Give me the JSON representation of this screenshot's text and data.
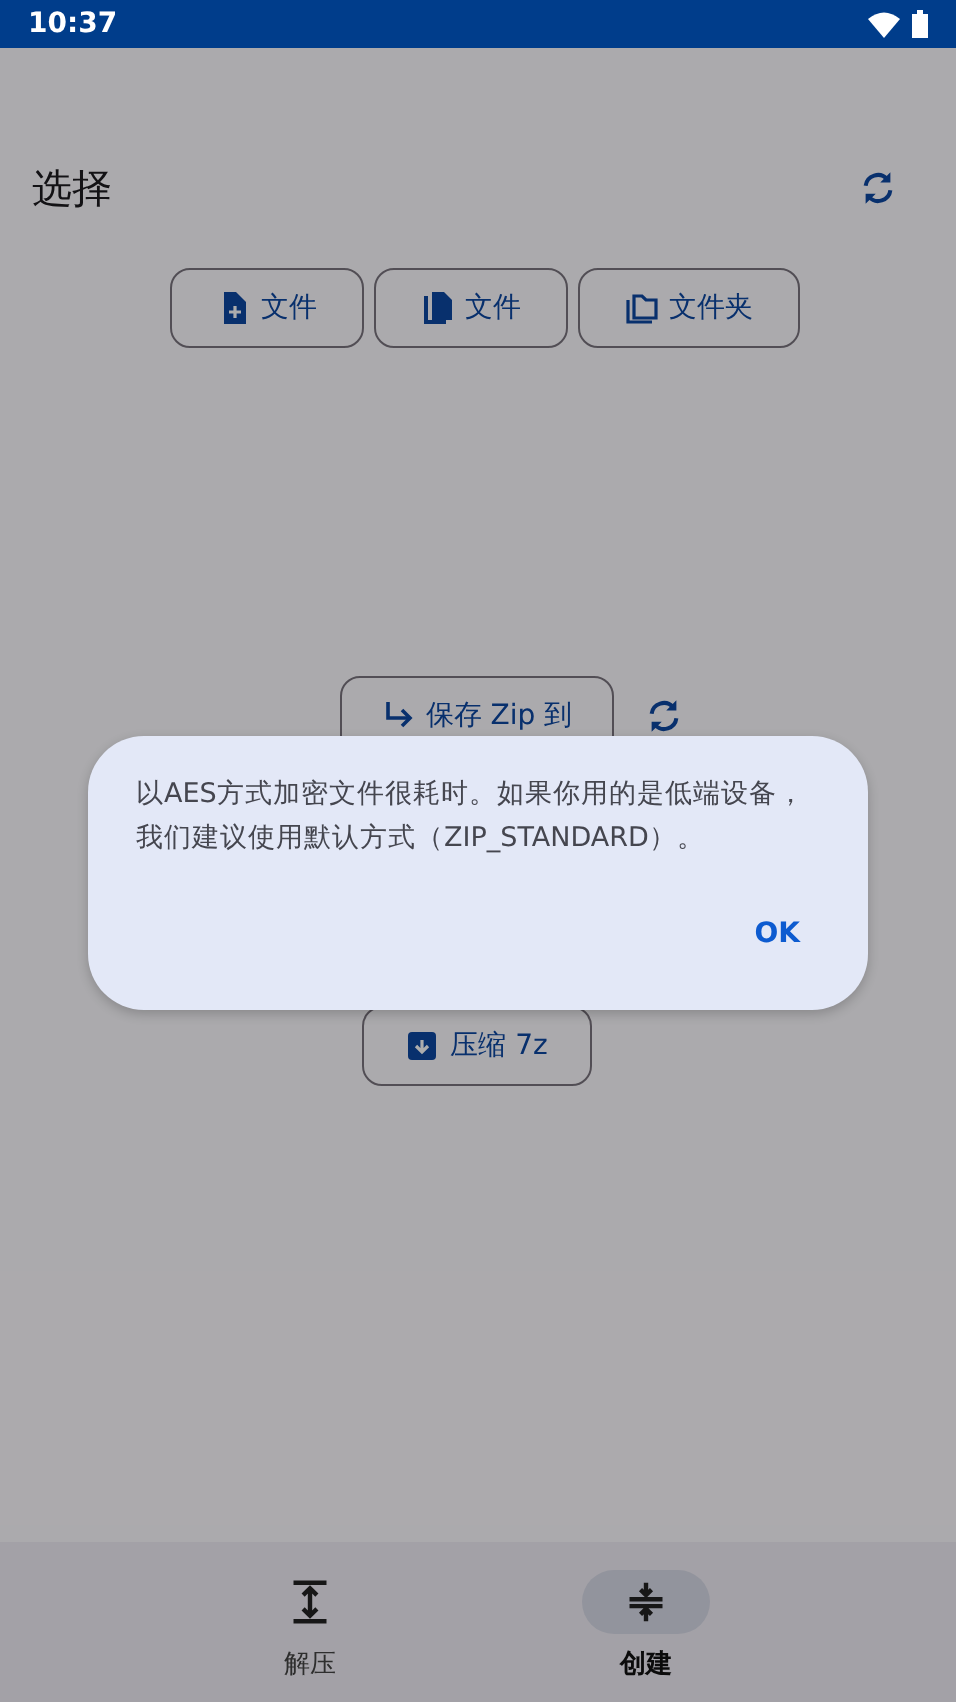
{
  "status_bar": {
    "time": "10:37"
  },
  "title": "选择",
  "source_buttons": [
    {
      "kind": "file-add",
      "label": "文件"
    },
    {
      "kind": "files",
      "label": "文件"
    },
    {
      "kind": "folder",
      "label": "文件夹"
    }
  ],
  "save_button": {
    "label": "保存 Zip 到"
  },
  "compress_button": {
    "label": "压缩 7z"
  },
  "dialog": {
    "message": "以AES方式加密文件很耗时。如果你用的是低端设备，我们建议使用默认方式（ZIP_STANDARD）。",
    "ok": "OK"
  },
  "nav": [
    {
      "label": "解压",
      "kind": "extract",
      "selected": false
    },
    {
      "label": "创建",
      "kind": "compress",
      "selected": true
    }
  ]
}
